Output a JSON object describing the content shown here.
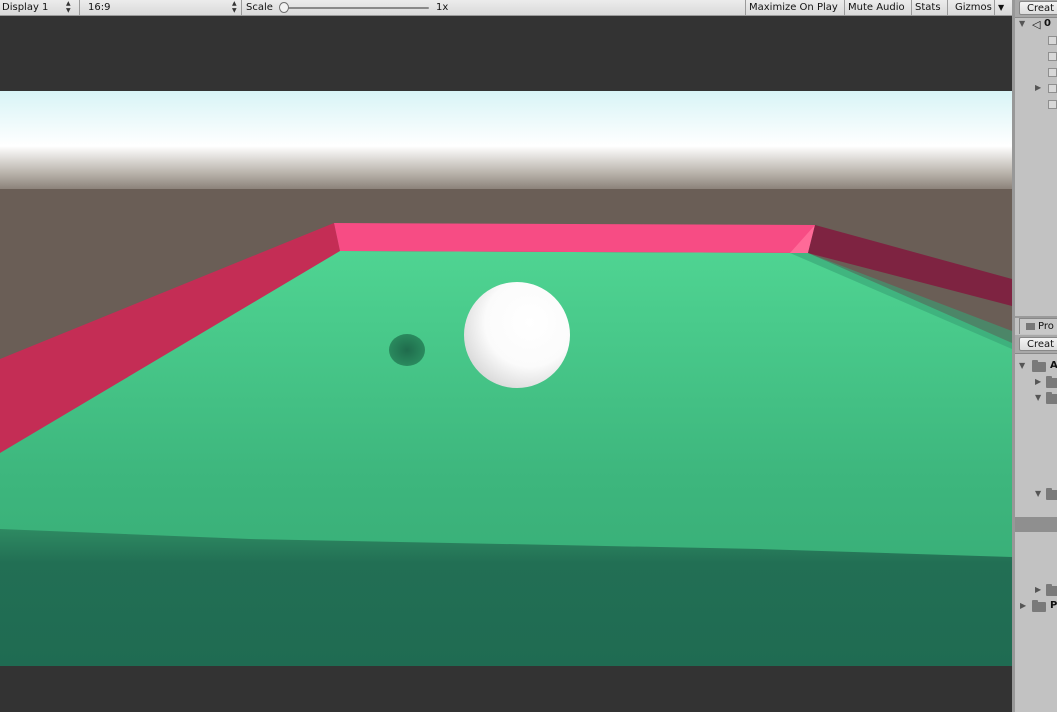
{
  "toolbar": {
    "display": "Display 1",
    "aspect": "16:9",
    "scale_label": "Scale",
    "scale_value": "1x",
    "maximize_on_play": "Maximize On Play",
    "mute_audio": "Mute Audio",
    "stats": "Stats",
    "gizmos": "Gizmos"
  },
  "hierarchy": {
    "create_label": "Creat",
    "scene_label": "0"
  },
  "project": {
    "tab_label": "Pro",
    "create_label": "Creat",
    "assets_label": "A",
    "packages_label": "P"
  },
  "colors": {
    "sky_top": "#d8f4f6",
    "horizon": "#ffffff",
    "backdrop": "#6a5e56",
    "floor": "#45c98a",
    "floor_near": "#1f6b52",
    "wall_front": "#f74c84",
    "wall_left": "#c42d55",
    "wall_right": "#7e2341",
    "ball": "#ffffff"
  }
}
